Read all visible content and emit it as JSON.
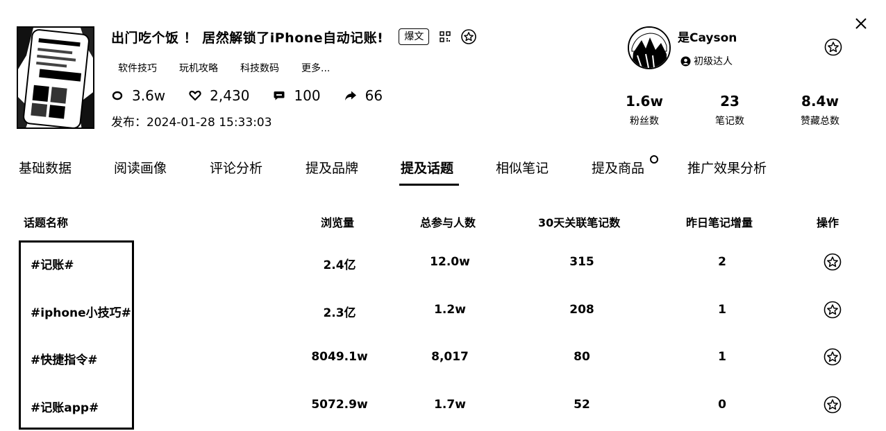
{
  "note": {
    "title": "出门吃个饭 ！ 居然解锁了iPhone自动记账!",
    "badge": "爆文",
    "tags": [
      "软件技巧",
      "玩机攻略",
      "科技数码",
      "更多..."
    ],
    "stats": {
      "views": "3.6w",
      "likes": "2,430",
      "comments": "100",
      "shares": "66"
    },
    "publish_label": "发布：",
    "publish_time": "2024-01-28 15:33:03"
  },
  "author": {
    "name": "是Cayson",
    "level": "初级达人",
    "fans": "1.6w",
    "fans_label": "粉丝数",
    "notes": "23",
    "notes_label": "笔记数",
    "likes_collects": "8.4w",
    "likes_collects_label": "赞藏总数"
  },
  "tabs": [
    "基础数据",
    "阅读画像",
    "评论分析",
    "提及品牌",
    "提及话题",
    "相似笔记",
    "提及商品",
    "推广效果分析"
  ],
  "active_tab": "提及话题",
  "table": {
    "headers": [
      "话题名称",
      "浏览量",
      "总参与人数",
      "30天关联笔记数",
      "昨日笔记增量",
      "操作"
    ],
    "rows": [
      {
        "topic": "#记账#",
        "views": "2.4亿",
        "participants": "12.0w",
        "notes_30d": "315",
        "yesterday": "2"
      },
      {
        "topic": "#iphone小技巧#",
        "views": "2.3亿",
        "participants": "1.2w",
        "notes_30d": "208",
        "yesterday": "1"
      },
      {
        "topic": "#快捷指令#",
        "views": "8049.1w",
        "participants": "8,017",
        "notes_30d": "80",
        "yesterday": "1"
      },
      {
        "topic": "#记账app#",
        "views": "5072.9w",
        "participants": "1.7w",
        "notes_30d": "52",
        "yesterday": "0"
      }
    ]
  },
  "icons": {
    "close": "close-icon",
    "qrcode": "qrcode-icon",
    "star": "star-icon",
    "eye": "eye-icon",
    "heart": "heart-icon",
    "comment": "comment-icon",
    "share": "share-icon",
    "level": "user-badge-icon"
  }
}
